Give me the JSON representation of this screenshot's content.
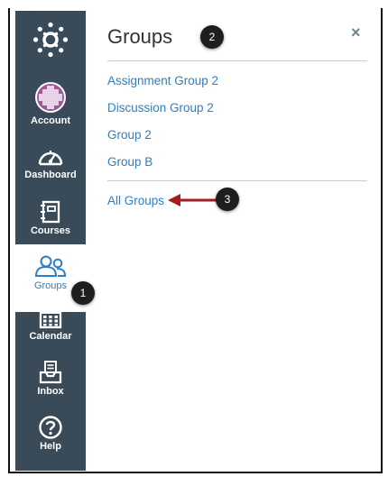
{
  "nav": {
    "items": [
      {
        "label": "Account"
      },
      {
        "label": "Dashboard"
      },
      {
        "label": "Courses"
      },
      {
        "label": "Groups"
      },
      {
        "label": "Calendar"
      },
      {
        "label": "Inbox"
      },
      {
        "label": "Help"
      }
    ]
  },
  "panel": {
    "title": "Groups",
    "close_label": "×",
    "groups": [
      "Assignment Group 2",
      "Discussion Group 2",
      "Group 2",
      "Group B"
    ],
    "all_groups": "All Groups"
  },
  "callouts": [
    "1",
    "2",
    "3"
  ],
  "colors": {
    "nav_bg": "#394b58",
    "link": "#2d7fc4",
    "arrow": "#a61d1d"
  }
}
